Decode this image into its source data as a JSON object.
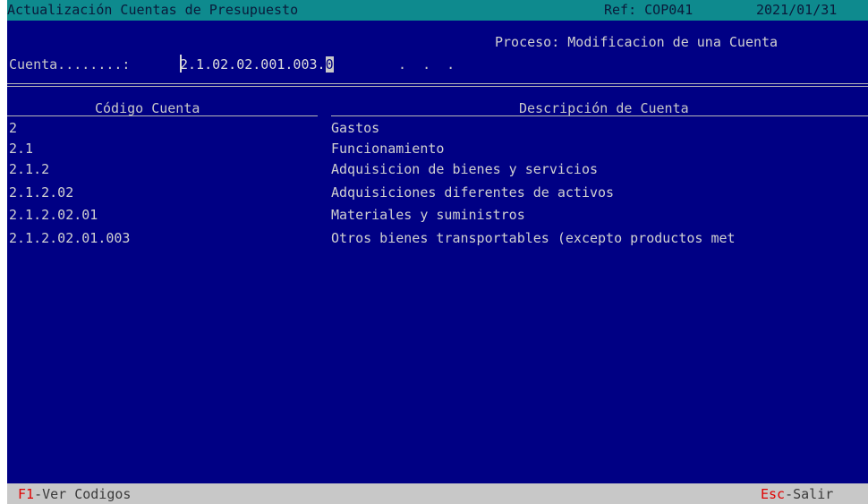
{
  "title_bar": {
    "title": "Actualización Cuentas de Presupuesto",
    "ref": "Ref: COP041",
    "date": "2021/01/31"
  },
  "process": {
    "text": "Proceso: Modificacion de una Cuenta"
  },
  "account_input": {
    "label": "Cuenta........:",
    "value_prefix": "2.1.02.02.001.003.",
    "value_current": "0",
    "value_rest": ".  .  ."
  },
  "table": {
    "headers": {
      "code": "Código Cuenta",
      "description": "Descripción de Cuenta"
    },
    "rows": [
      {
        "code": "2",
        "description": "Gastos"
      },
      {
        "code": "2.1",
        "description": "Funcionamiento"
      },
      {
        "code": "2.1.2",
        "description": "Adquisicion de bienes y servicios"
      },
      {
        "code": "2.1.2.02",
        "description": "Adquisiciones diferentes de activos"
      },
      {
        "code": "2.1.2.02.01",
        "description": "Materiales y suministros"
      },
      {
        "code": "2.1.2.02.01.003",
        "description": "Otros bienes transportables (excepto productos met"
      }
    ]
  },
  "status_bar": {
    "f1_key": "F1",
    "f1_label": "-Ver Codigos",
    "esc_key": "Esc",
    "esc_label": "-Salir"
  },
  "colors": {
    "background": "#000084",
    "titlebar": "#0e8a8e",
    "statusbar": "#c8c8c8",
    "hotkey": "#e00000"
  }
}
